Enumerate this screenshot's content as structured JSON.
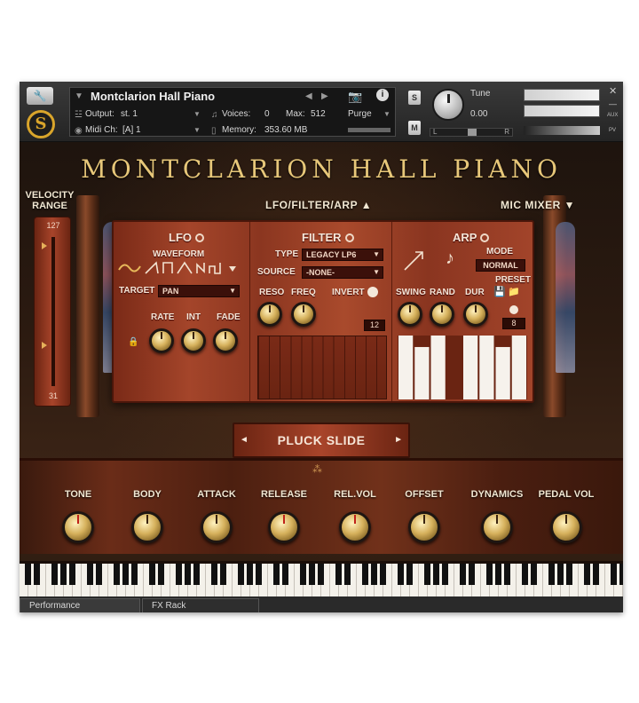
{
  "header": {
    "instrument_name": "Montclarion Hall Piano",
    "output_label": "Output:",
    "output_value": "st. 1",
    "voices_label": "Voices:",
    "voices_value": "0",
    "max_label": "Max:",
    "max_value": "512",
    "purge_label": "Purge",
    "midi_label": "Midi Ch:",
    "midi_value": "[A] 1",
    "memory_label": "Memory:",
    "memory_value": "353.60 MB",
    "tune_label": "Tune",
    "tune_value": "0.00",
    "s_label": "S",
    "m_label": "M",
    "l_label": "L",
    "r_label": "R",
    "aux_label": "AUX",
    "pv_label": "PV",
    "logo_letter": "S",
    "info_label": "i"
  },
  "instrument": {
    "title": "Montclarion Hall Piano",
    "nav_lfo_filter_arp": "LFO/FILTER/ARP ▲",
    "nav_mic_mixer": "MIC MIXER ▼",
    "velocity_label_1": "VELOCITY",
    "velocity_label_2": "RANGE",
    "velocity_max": "127",
    "velocity_min": "31"
  },
  "lfo": {
    "title": "LFO",
    "waveform_label": "WAVEFORM",
    "target_label": "TARGET",
    "target_value": "PAN",
    "rate_label": "RATE",
    "int_label": "INT",
    "fade_label": "FADE"
  },
  "filter": {
    "title": "FILTER",
    "type_label": "TYPE",
    "type_value": "LEGACY LP6",
    "source_label": "SOURCE",
    "source_value": "-NONE-",
    "reso_label": "RESO",
    "freq_label": "FREQ",
    "invert_label": "INVERT",
    "steps_value": "12"
  },
  "arp": {
    "title": "ARP",
    "mode_label": "MODE",
    "mode_value": "NORMAL",
    "preset_label": "PRESET",
    "swing_label": "SWING",
    "rand_label": "RAND",
    "dur_label": "DUR",
    "steps_value": "8",
    "step_levels": [
      1.0,
      0.82,
      1.0,
      0.0,
      1.0,
      1.0,
      0.82,
      1.0
    ]
  },
  "preset_selector": {
    "name": "PLUCK SLIDE",
    "prev": "◄",
    "next": "►"
  },
  "front_controls": [
    {
      "label": "TONE"
    },
    {
      "label": "BODY"
    },
    {
      "label": "ATTACK"
    },
    {
      "label": "RELEASE"
    },
    {
      "label": "REL.VOL"
    },
    {
      "label": "OFFSET"
    },
    {
      "label": "DYNAMICS"
    },
    {
      "label": "PEDAL VOL"
    }
  ],
  "tabs": {
    "performance": "Performance",
    "fx_rack": "FX Rack"
  },
  "colors": {
    "accent_gold": "#e7c779",
    "panel_red": "#a4452a",
    "header_dark": "#242424"
  }
}
